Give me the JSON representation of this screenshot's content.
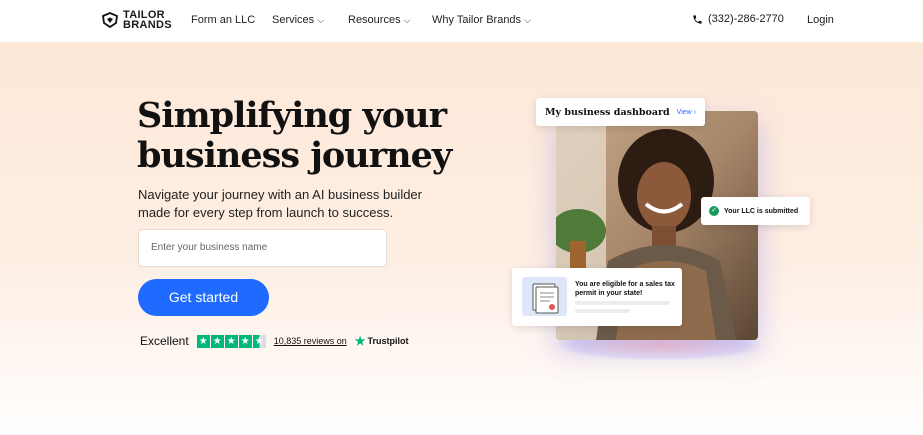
{
  "brand": {
    "name_line1": "TAILOR",
    "name_line2": "BRANDS",
    "accent": "#1f6bff"
  },
  "nav": {
    "items": [
      {
        "label": "Form an LLC",
        "dropdown": false
      },
      {
        "label": "Services",
        "dropdown": true
      },
      {
        "label": "Resources",
        "dropdown": true
      },
      {
        "label": "Why Tailor Brands",
        "dropdown": true
      }
    ],
    "phone": "(332)-286-2770",
    "login": "Login"
  },
  "hero": {
    "headline_line1": "Simplifying your",
    "headline_line2": "business journey",
    "subtext": "Navigate your journey with an AI business builder made for every step from launch to success.",
    "input_placeholder": "Enter your business name",
    "cta": "Get started"
  },
  "rating": {
    "word": "Excellent",
    "stars": 4.5,
    "reviews": "10,835 reviews on",
    "provider": "Trustpilot",
    "provider_color": "#00b67a"
  },
  "showcase": {
    "dashboard_title": "My business dashboard",
    "dashboard_link": "View ›",
    "llc_status": "Your LLC is submitted",
    "permit_text": "You are eligible for a sales tax permit in your state!"
  }
}
